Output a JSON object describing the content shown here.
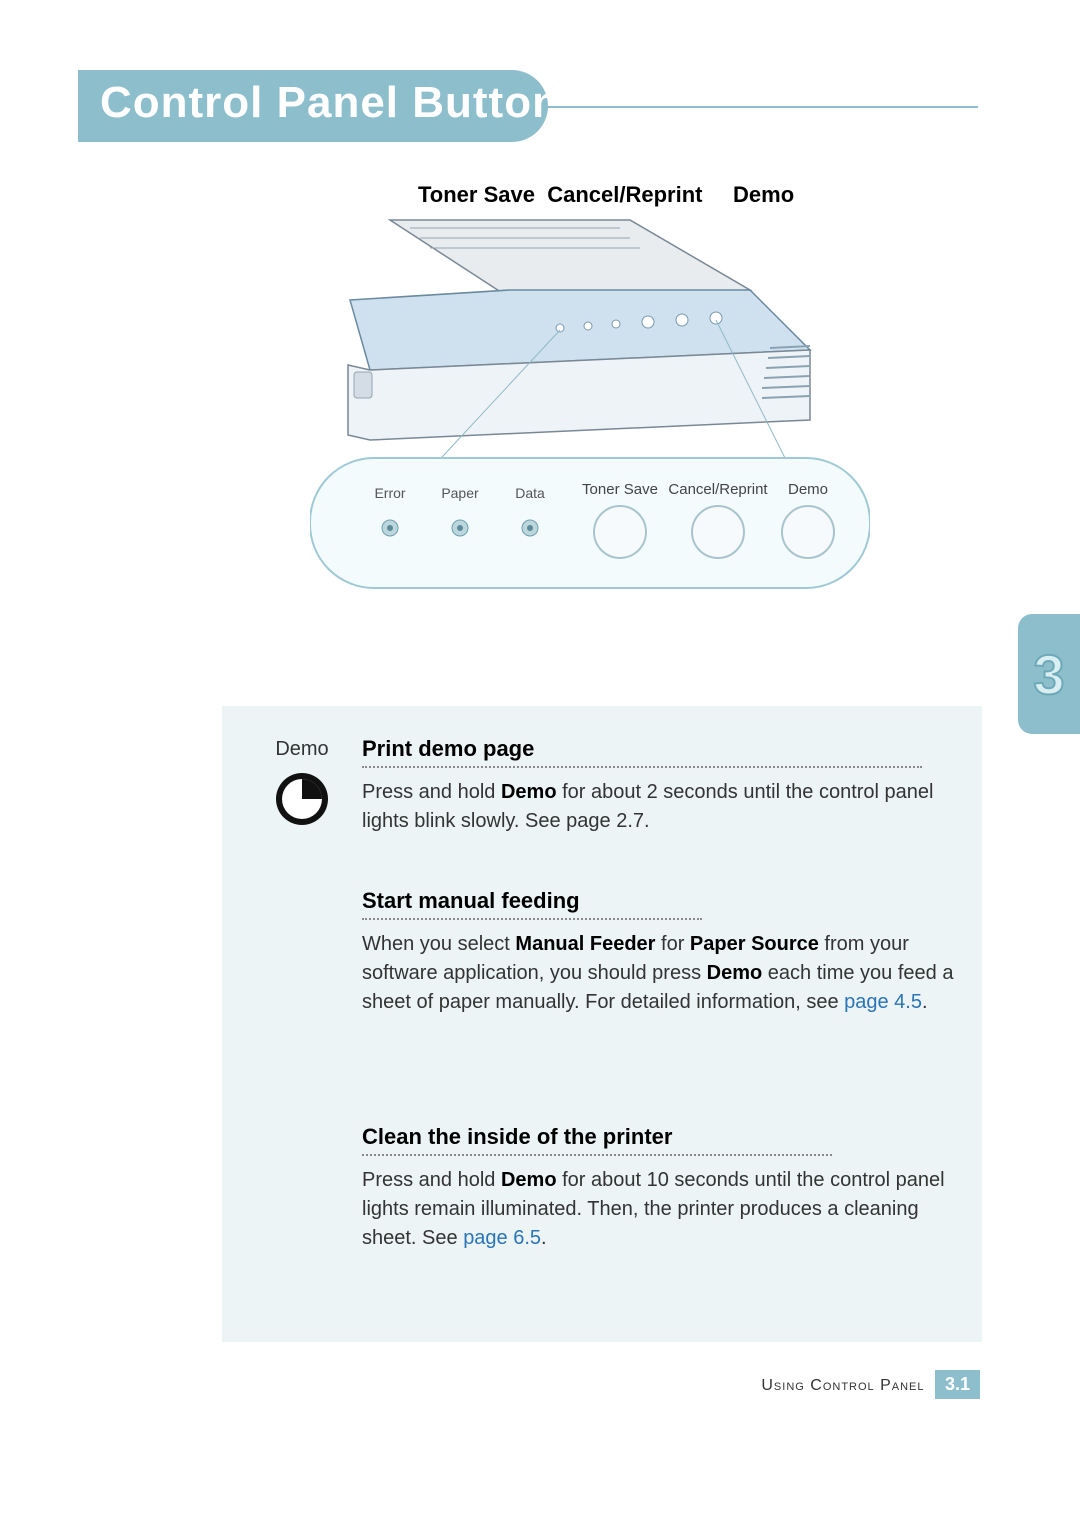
{
  "title": "Control Panel Buttons",
  "intro_labels": {
    "toner_save": "Toner Save",
    "cancel_reprint": "Cancel/Reprint",
    "demo": "Demo"
  },
  "panel": {
    "leds": [
      "Error",
      "Paper",
      "Data"
    ],
    "buttons": [
      "Toner Save",
      "Cancel/Reprint",
      "Demo"
    ]
  },
  "chapter_number": "3",
  "demo_col_label": "Demo",
  "sections": {
    "s1": {
      "head": "Print demo page",
      "body_prefix": "Press and hold ",
      "body_bold": "Demo",
      "body_suffix": " for about 2 seconds until the control panel lights blink slowly. See page 2.7."
    },
    "s2": {
      "head": "Start manual feeding",
      "p1_a": "When you select ",
      "p1_b": "Manual Feeder",
      "p1_c": " for ",
      "p1_d": "Paper Source",
      "p1_e": " from your software application, you should press ",
      "p1_f": "Demo",
      "p1_g": " each time you feed a sheet of paper manually. For detailed information, see ",
      "link_text": "page 4.5",
      "p1_h": "."
    },
    "s3": {
      "head": "Clean the inside of the printer",
      "p_a": "Press and hold ",
      "p_b": "Demo",
      "p_c": " for about 10 seconds until the control panel lights remain illuminated. Then, the printer produces a cleaning sheet. See ",
      "link_text": "page 6.5",
      "p_d": "."
    }
  },
  "footer": {
    "label": "Using Control Panel",
    "page": "3.1"
  }
}
